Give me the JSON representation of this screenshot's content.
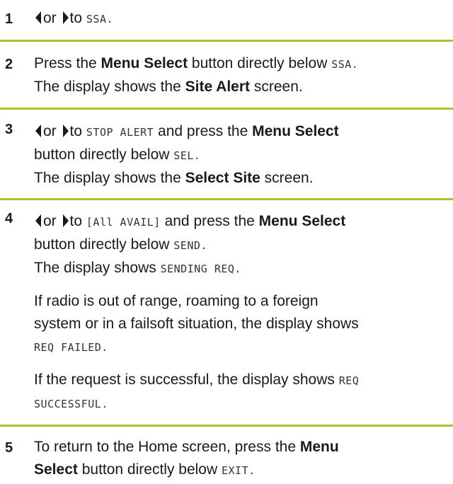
{
  "steps": [
    {
      "number": "1",
      "parts": {
        "or": "or",
        "to": "to",
        "code": "SSA."
      }
    },
    {
      "number": "2",
      "parts": {
        "t1": "Press the ",
        "b1": "Menu Select",
        "t2": " button directly below ",
        "code": "SSA.",
        "t3": "The display shows the ",
        "b2": "Site Alert",
        "t4": " screen."
      }
    },
    {
      "number": "3",
      "parts": {
        "or": "or",
        "to": "to",
        "code1": "STOP ALERT",
        "t1": " and press the ",
        "b1": "Menu Select",
        "t2": "button directly below ",
        "code2": "SEL.",
        "t3": "The display shows the ",
        "b2": "Select Site",
        "t4": " screen."
      }
    },
    {
      "number": "4",
      "parts": {
        "or": "or",
        "to": "to",
        "code1": "[All AVAIL]",
        "t1": " and press the ",
        "b1": "Menu Select",
        "t2": "button directly below ",
        "code2": "SEND.",
        "t3": "The display shows ",
        "code3": "SENDING REQ.",
        "p1a": "If radio is out of range, roaming to a foreign",
        "p1b": "system or in a failsoft situation, the display shows",
        "p1c": "REQ FAILED.",
        "p2a": "If the request is successful, the display shows ",
        "p2b": "REQ",
        "p2c": "SUCCESSFUL."
      }
    },
    {
      "number": "5",
      "parts": {
        "t1": "To return to the Home screen, press the ",
        "b1": "Menu",
        "b2": "Select",
        "t2": " button directly below ",
        "code": "EXIT."
      }
    }
  ],
  "icons": {
    "left": "left-arrow-icon",
    "right": "right-arrow-icon"
  },
  "colors": {
    "rule": "#b5bd33",
    "text": "#1a1a1a"
  }
}
